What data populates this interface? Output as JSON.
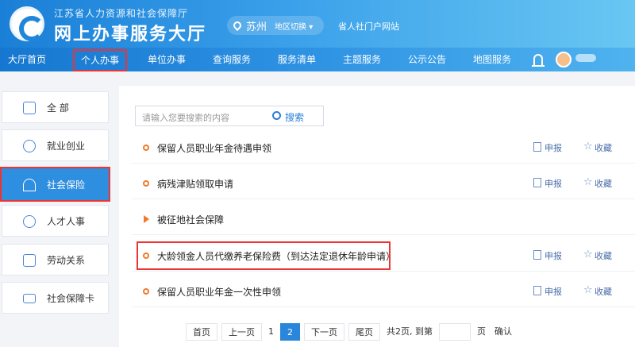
{
  "header": {
    "org_name": "江苏省人力资源和社会保障厅",
    "hall_title": "网上办事服务大厅",
    "city": "苏州",
    "city_switch": "地区切换 ▾",
    "portal_link": "省人社门户网站"
  },
  "nav": {
    "items": [
      "大厅首页",
      "个人办事",
      "单位办事",
      "查询服务",
      "服务清单",
      "主题服务",
      "公示公告",
      "地图服务"
    ],
    "active_item": "个人办事"
  },
  "sidebar": {
    "items": [
      "全 部",
      "就业创业",
      "社会保险",
      "人才人事",
      "劳动关系",
      "社会保障卡"
    ],
    "selected_item": "社会保险"
  },
  "search": {
    "placeholder": "请输入您要搜索的内容",
    "button_label": "搜索"
  },
  "services": [
    {
      "title": "保留人员职业年金待遇申领",
      "apply": "申报",
      "favorite": "收藏"
    },
    {
      "title": "病残津贴领取申请",
      "apply": "申报",
      "favorite": "收藏"
    },
    {
      "title": "被征地社会保障",
      "apply": "",
      "favorite": ""
    },
    {
      "title": "大龄领金人员代缴养老保险费（到达法定退休年龄申请）",
      "apply": "申报",
      "favorite": "收藏"
    },
    {
      "title": "保留人员职业年金一次性申领",
      "apply": "申报",
      "favorite": "收藏"
    }
  ],
  "pagination": {
    "first": "首页",
    "prev": "上一页",
    "page1": "1",
    "page2": "2",
    "next": "下一页",
    "last": "尾页",
    "total_text": "共2页, 到第",
    "page_suffix": "页",
    "confirm": "确认",
    "current_page": 2
  },
  "colors": {
    "accent": "#2a86db",
    "highlight": "#e33333",
    "bullet": "#f07a2a"
  }
}
